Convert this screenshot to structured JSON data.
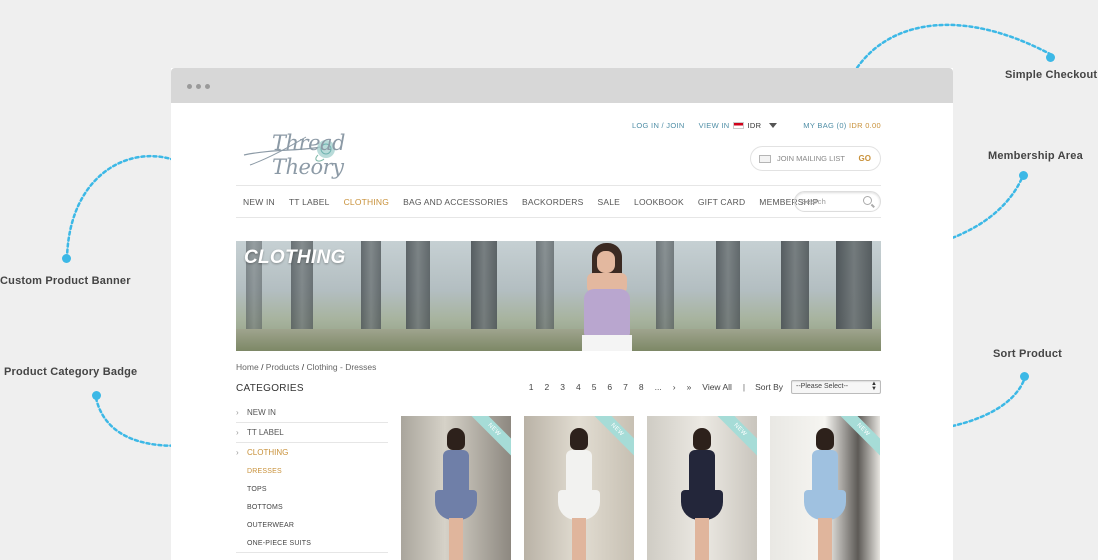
{
  "callouts": {
    "simple_checkout": "Simple Checkout",
    "membership_area": "Membership Area",
    "custom_product_banner": "Custom Product Banner",
    "product_category_badge": "Product Category Badge",
    "sort_product": "Sort Product"
  },
  "brand": {
    "logo_text": "Thread Theory"
  },
  "header": {
    "login": "LOG IN / JOIN",
    "view_in": "VIEW IN",
    "currency": "IDR",
    "bag_label": "MY BAG",
    "bag_count": "(0)",
    "bag_amount": "IDR 0.00",
    "mailing_list": "JOIN MAILING LIST",
    "mailing_go": "GO"
  },
  "nav": {
    "items": [
      "NEW IN",
      "TT LABEL",
      "CLOTHING",
      "BAG AND ACCESSORIES",
      "BACKORDERS",
      "SALE",
      "LOOKBOOK",
      "GIFT CARD",
      "MEMBERSHIP"
    ],
    "search_placeholder": "Search"
  },
  "banner": {
    "title": "CLOTHING"
  },
  "breadcrumb": {
    "home": "Home",
    "products": "Products",
    "current": "Clothing - Dresses"
  },
  "categories": {
    "title": "CATEGORIES",
    "items": [
      "NEW IN",
      "TT LABEL",
      "CLOTHING"
    ],
    "sub_items": [
      "DRESSES",
      "TOPS",
      "BOTTOMS",
      "OUTERWEAR",
      "ONE-PIECE SUITS"
    ]
  },
  "pagination": {
    "pages": [
      "1",
      "2",
      "3",
      "4",
      "5",
      "6",
      "7",
      "8",
      "...",
      "›",
      "»"
    ],
    "view_all": "View All",
    "sort_by": "Sort By",
    "sort_selected": "--Please Select--"
  },
  "products": {
    "badge": "NEW",
    "dress_colors": [
      "#6f7fa8",
      "#f2f2f0",
      "#23263a",
      "#9fc1e0"
    ]
  },
  "colors": {
    "accent": "#c8913a",
    "link": "#4f8ea6",
    "callout": "#3cb8e6"
  }
}
